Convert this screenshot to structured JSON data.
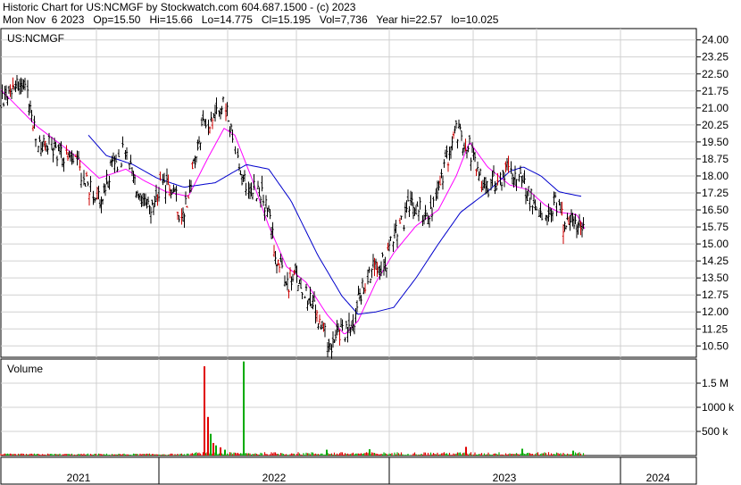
{
  "header": {
    "line1": "Historic Chart for US:NCMGF by Stockwatch.com 604.687.1500 - (c) 2023",
    "line2": "Mon Nov  6 2023   Op=15.50   Hi=15.66   Lo=14.775   Cl=15.195   Vol=7,736   Year hi=22.57   lo=10.025"
  },
  "chart_data": [
    {
      "type": "candlestick",
      "title": "US:NCMGF",
      "ylim": [
        10.0,
        24.5
      ],
      "yticks": [
        "24.00",
        "23.25",
        "22.50",
        "21.75",
        "21.00",
        "20.25",
        "19.50",
        "18.75",
        "18.00",
        "17.25",
        "16.50",
        "15.75",
        "15.00",
        "14.25",
        "13.50",
        "12.75",
        "12.00",
        "11.25",
        "10.50"
      ],
      "ytick_values": [
        24.0,
        23.25,
        22.5,
        21.75,
        21.0,
        20.25,
        19.5,
        18.75,
        18.0,
        17.25,
        16.5,
        15.75,
        15.0,
        14.25,
        13.5,
        12.75,
        12.0,
        11.25,
        10.5
      ],
      "x_labels": [
        "2021",
        "2022",
        "2023",
        "2024"
      ],
      "grid": true,
      "anchors": [
        [
          0,
          21.2
        ],
        [
          15,
          22.2
        ],
        [
          30,
          21.6
        ],
        [
          40,
          19.4
        ],
        [
          55,
          19.3
        ],
        [
          70,
          19.0
        ],
        [
          85,
          18.5
        ],
        [
          100,
          17.4
        ],
        [
          112,
          16.8
        ],
        [
          125,
          18.5
        ],
        [
          140,
          19.1
        ],
        [
          150,
          17.6
        ],
        [
          160,
          16.6
        ],
        [
          168,
          16.4
        ],
        [
          180,
          17.6
        ],
        [
          195,
          17.3
        ],
        [
          202,
          16.0
        ],
        [
          212,
          17.6
        ],
        [
          225,
          20.0
        ],
        [
          238,
          20.8
        ],
        [
          250,
          21.2
        ],
        [
          258,
          20.0
        ],
        [
          268,
          18.0
        ],
        [
          280,
          17.5
        ],
        [
          290,
          17.3
        ],
        [
          298,
          16.5
        ],
        [
          308,
          14.6
        ],
        [
          318,
          13.2
        ],
        [
          330,
          13.6
        ],
        [
          340,
          13.1
        ],
        [
          352,
          12.0
        ],
        [
          362,
          11.0
        ],
        [
          372,
          10.6
        ],
        [
          382,
          11.2
        ],
        [
          392,
          11.1
        ],
        [
          400,
          12.5
        ],
        [
          410,
          13.4
        ],
        [
          420,
          14.4
        ],
        [
          430,
          14.0
        ],
        [
          440,
          15.4
        ],
        [
          450,
          16.0
        ],
        [
          460,
          16.8
        ],
        [
          470,
          16.5
        ],
        [
          480,
          16.2
        ],
        [
          490,
          17.3
        ],
        [
          500,
          18.8
        ],
        [
          510,
          20.0
        ],
        [
          518,
          19.6
        ],
        [
          525,
          19.3
        ],
        [
          535,
          18.0
        ],
        [
          545,
          17.5
        ],
        [
          555,
          17.8
        ],
        [
          565,
          18.2
        ],
        [
          575,
          18.3
        ],
        [
          585,
          17.6
        ],
        [
          595,
          16.9
        ],
        [
          605,
          16.5
        ],
        [
          615,
          16.6
        ],
        [
          625,
          16.9
        ],
        [
          632,
          15.5
        ],
        [
          640,
          16.2
        ],
        [
          648,
          15.8
        ],
        [
          655,
          15.2
        ]
      ],
      "moving_averages": [
        {
          "color": "#ff00ff",
          "anchors": [
            [
              0,
              21.8
            ],
            [
              40,
              20.2
            ],
            [
              80,
              19.0
            ],
            [
              110,
              17.9
            ],
            [
              140,
              18.3
            ],
            [
              160,
              17.8
            ],
            [
              185,
              17.3
            ],
            [
              210,
              17.1
            ],
            [
              232,
              18.8
            ],
            [
              250,
              20.1
            ],
            [
              262,
              19.8
            ],
            [
              280,
              18.0
            ],
            [
              300,
              15.8
            ],
            [
              320,
              14.0
            ],
            [
              342,
              13.3
            ],
            [
              365,
              11.9
            ],
            [
              385,
              11.0
            ],
            [
              400,
              11.6
            ],
            [
              420,
              13.3
            ],
            [
              440,
              14.6
            ],
            [
              465,
              15.8
            ],
            [
              490,
              16.5
            ],
            [
              510,
              18.0
            ],
            [
              525,
              19.5
            ],
            [
              545,
              18.4
            ],
            [
              570,
              17.6
            ],
            [
              590,
              17.4
            ],
            [
              610,
              16.7
            ],
            [
              625,
              16.4
            ],
            [
              645,
              16.3
            ],
            [
              655,
              15.6
            ]
          ]
        },
        {
          "color": "#0000cc",
          "anchors": [
            [
              98,
              19.8
            ],
            [
              118,
              18.9
            ],
            [
              148,
              18.5
            ],
            [
              175,
              17.9
            ],
            [
              205,
              17.5
            ],
            [
              240,
              17.7
            ],
            [
              275,
              18.5
            ],
            [
              300,
              18.3
            ],
            [
              325,
              16.9
            ],
            [
              355,
              14.5
            ],
            [
              382,
              12.7
            ],
            [
              400,
              11.9
            ],
            [
              420,
              12.0
            ],
            [
              440,
              12.2
            ],
            [
              465,
              13.5
            ],
            [
              490,
              15.0
            ],
            [
              515,
              16.4
            ],
            [
              545,
              17.3
            ],
            [
              570,
              18.2
            ],
            [
              585,
              18.4
            ],
            [
              605,
              18.0
            ],
            [
              625,
              17.3
            ],
            [
              650,
              17.1
            ]
          ]
        }
      ]
    },
    {
      "type": "bar",
      "title": "Volume",
      "ylim": [
        0,
        2000
      ],
      "yticks": [
        "1.5 M",
        "1000 k",
        "500 k"
      ],
      "ytick_values": [
        1500,
        1000,
        500
      ],
      "spikes": [
        {
          "x": 228,
          "value": 1850,
          "color": "#e00000"
        },
        {
          "x": 232,
          "value": 800,
          "color": "#e00000"
        },
        {
          "x": 235,
          "value": 450,
          "color": "#00aa00"
        },
        {
          "x": 238,
          "value": 260,
          "color": "#e00000"
        },
        {
          "x": 241,
          "value": 210,
          "color": "#00aa00"
        },
        {
          "x": 246,
          "value": 170,
          "color": "#e00000"
        },
        {
          "x": 251,
          "value": 120,
          "color": "#00aa00"
        },
        {
          "x": 272,
          "value": 1950,
          "color": "#00aa00"
        },
        {
          "x": 365,
          "value": 120,
          "color": "#00aa00"
        },
        {
          "x": 413,
          "value": 130,
          "color": "#00aa00"
        },
        {
          "x": 521,
          "value": 180,
          "color": "#e00000"
        },
        {
          "x": 584,
          "value": 140,
          "color": "#00aa00"
        },
        {
          "x": 641,
          "value": 100,
          "color": "#00aa00"
        }
      ]
    }
  ]
}
